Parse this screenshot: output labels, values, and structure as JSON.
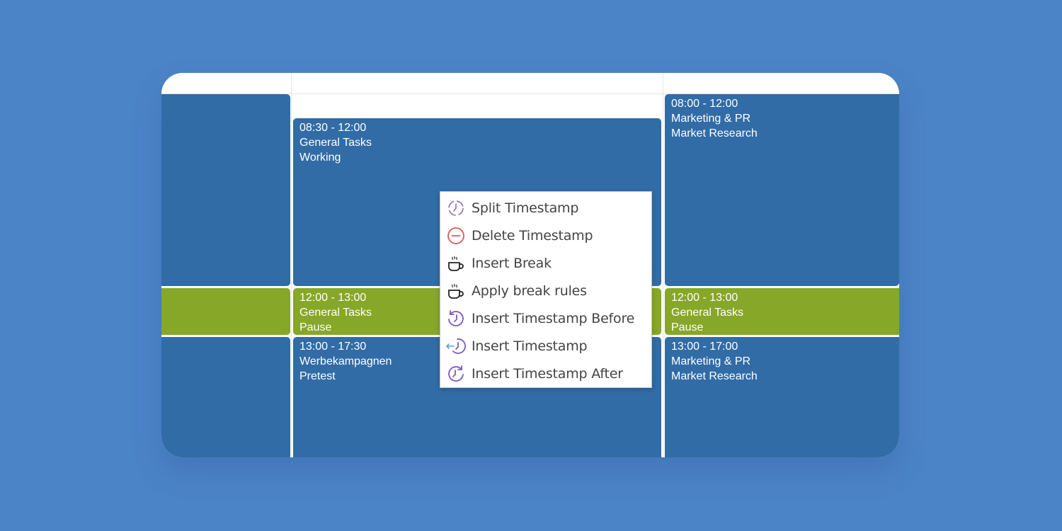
{
  "calendar": {
    "columns": [
      {
        "entries": [
          {
            "time": "",
            "project": "",
            "task": "",
            "color": "#316ca6"
          },
          {
            "time": "",
            "project": "",
            "task": "",
            "color": "#87a728"
          },
          {
            "time": "",
            "project": "",
            "task": "",
            "color": "#316ca6"
          }
        ]
      },
      {
        "entries": [
          {
            "time": "08:30 - 12:00",
            "project": "General Tasks",
            "task": "Working",
            "color": "#316ca6"
          },
          {
            "time": "12:00 - 13:00",
            "project": "General Tasks",
            "task": "Pause",
            "color": "#87a728"
          },
          {
            "time": "13:00 - 17:30",
            "project": "Werbekampagnen",
            "task": "Pretest",
            "color": "#316ca6"
          }
        ]
      },
      {
        "entries": [
          {
            "time": "08:00 - 12:00",
            "project": "Marketing & PR",
            "task": "Market Research",
            "color": "#316ca6"
          },
          {
            "time": "12:00 - 13:00",
            "project": "General Tasks",
            "task": "Pause",
            "color": "#87a728"
          },
          {
            "time": "13:00 - 17:00",
            "project": "Marketing & PR",
            "task": "Market Research",
            "color": "#316ca6"
          }
        ]
      }
    ]
  },
  "context_menu": {
    "items": [
      {
        "label": "Split Timestamp",
        "icon": "split-clock-icon",
        "icon_color": "#8a6bc4"
      },
      {
        "label": "Delete Timestamp",
        "icon": "minus-circle-icon",
        "icon_color": "#e05555"
      },
      {
        "label": "Insert Break",
        "icon": "coffee-cup-icon",
        "icon_color": "#222222"
      },
      {
        "label": "Apply break rules",
        "icon": "coffee-cup-icon",
        "icon_color": "#222222"
      },
      {
        "label": "Insert Timestamp Before",
        "icon": "clock-back-icon",
        "icon_color": "#7a5bbf"
      },
      {
        "label": "Insert Timestamp",
        "icon": "clock-insert-icon",
        "icon_color": "#7a5bbf"
      },
      {
        "label": "Insert Timestamp After",
        "icon": "clock-forward-icon",
        "icon_color": "#7a5bbf"
      }
    ]
  }
}
